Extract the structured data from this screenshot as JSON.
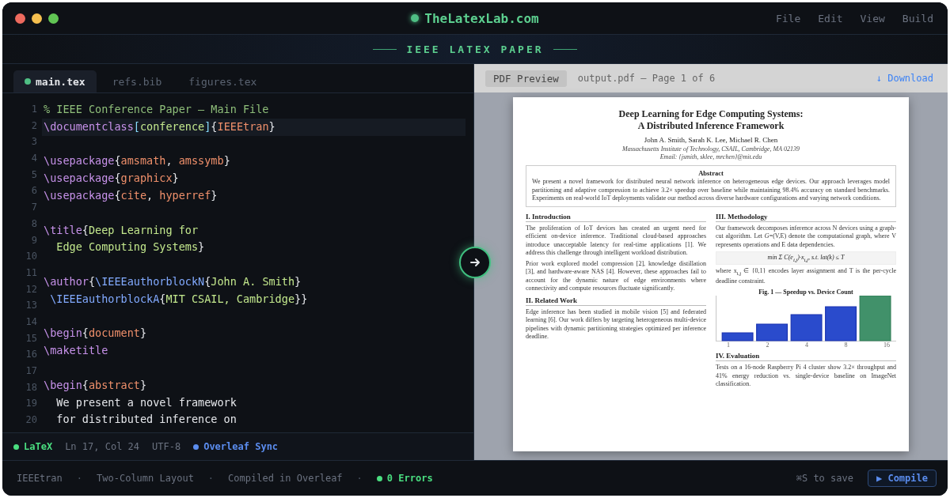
{
  "window": {
    "title": "TheLatexLab.com",
    "menu": [
      "File",
      "Edit",
      "View",
      "Build"
    ]
  },
  "banner": "IEEE LATEX PAPER",
  "editor": {
    "tabs": [
      {
        "label": "main.tex",
        "selected": true
      },
      {
        "label": "refs.bib",
        "selected": false
      },
      {
        "label": "figures.tex",
        "selected": false
      }
    ],
    "line_numbers": [
      "1",
      "2",
      "3",
      "4",
      "5",
      "6",
      "7",
      "8",
      "9",
      "10",
      "11",
      "12",
      "13",
      "14",
      "15",
      "16",
      "17",
      "18",
      "19",
      "20"
    ],
    "lines": [
      {
        "current": false,
        "tokens": [
          {
            "kind": "comment",
            "t": "% IEEE Conference Paper — Main File"
          }
        ]
      },
      {
        "current": true,
        "tokens": [
          {
            "kind": "cmd",
            "t": "\\documentclass"
          },
          {
            "kind": "opt",
            "t": "["
          },
          {
            "kind": "title",
            "t": "conference"
          },
          {
            "kind": "opt",
            "t": "]"
          },
          {
            "kind": "punct",
            "t": "{"
          },
          {
            "kind": "arg",
            "t": "IEEEtran"
          },
          {
            "kind": "punct",
            "t": "}"
          }
        ]
      },
      {
        "current": false
      },
      {
        "current": false,
        "tokens": [
          {
            "kind": "cmd",
            "t": "\\usepackage"
          },
          {
            "kind": "punct",
            "t": "{"
          },
          {
            "kind": "arg",
            "t": "amsmath"
          },
          {
            "kind": "punct",
            "t": ", "
          },
          {
            "kind": "arg",
            "t": "amssymb"
          },
          {
            "kind": "punct",
            "t": "}"
          }
        ]
      },
      {
        "current": false,
        "tokens": [
          {
            "kind": "cmd",
            "t": "\\usepackage"
          },
          {
            "kind": "punct",
            "t": "{"
          },
          {
            "kind": "arg",
            "t": "graphicx"
          },
          {
            "kind": "punct",
            "t": "}"
          }
        ]
      },
      {
        "current": false,
        "tokens": [
          {
            "kind": "cmd",
            "t": "\\usepackage"
          },
          {
            "kind": "punct",
            "t": "{"
          },
          {
            "kind": "arg",
            "t": "cite"
          },
          {
            "kind": "punct",
            "t": ", "
          },
          {
            "kind": "arg",
            "t": "hyperref"
          },
          {
            "kind": "punct",
            "t": "}"
          }
        ]
      },
      {
        "current": false
      },
      {
        "current": false,
        "tokens": [
          {
            "kind": "cmd",
            "t": "\\title"
          },
          {
            "kind": "punct",
            "t": "{"
          },
          {
            "kind": "title",
            "t": "Deep Learning for"
          }
        ]
      },
      {
        "current": false,
        "tokens": [
          {
            "kind": "title",
            "t": "  Edge Computing Systems"
          },
          {
            "kind": "punct",
            "t": "}"
          }
        ]
      },
      {
        "current": false
      },
      {
        "current": false,
        "tokens": [
          {
            "kind": "cmd",
            "t": "\\author"
          },
          {
            "kind": "punct",
            "t": "{"
          },
          {
            "kind": "ref",
            "t": "\\IEEEauthorblockN"
          },
          {
            "kind": "punct",
            "t": "{"
          },
          {
            "kind": "title",
            "t": "John A. Smith"
          },
          {
            "kind": "punct",
            "t": "}"
          }
        ]
      },
      {
        "current": false,
        "tokens": [
          {
            "kind": "ref",
            "t": " \\IEEEauthorblockA"
          },
          {
            "kind": "punct",
            "t": "{"
          },
          {
            "kind": "title",
            "t": "MIT CSAIL, Cambridge"
          },
          {
            "kind": "punct",
            "t": "}}"
          }
        ]
      },
      {
        "current": false
      },
      {
        "current": false,
        "tokens": [
          {
            "kind": "cmd",
            "t": "\\begin"
          },
          {
            "kind": "punct",
            "t": "{"
          },
          {
            "kind": "arg",
            "t": "document"
          },
          {
            "kind": "punct",
            "t": "}"
          }
        ]
      },
      {
        "current": false,
        "tokens": [
          {
            "kind": "cmd",
            "t": "\\maketitle"
          }
        ]
      },
      {
        "current": false
      },
      {
        "current": false,
        "tokens": [
          {
            "kind": "cmd",
            "t": "\\begin"
          },
          {
            "kind": "punct",
            "t": "{"
          },
          {
            "kind": "arg",
            "t": "abstract"
          },
          {
            "kind": "punct",
            "t": "}"
          }
        ]
      },
      {
        "current": false,
        "tokens": [
          {
            "kind": "text",
            "t": "  We present a novel framework"
          }
        ]
      },
      {
        "current": false,
        "tokens": [
          {
            "kind": "text",
            "t": "  for distributed inference on"
          }
        ]
      }
    ],
    "status": [
      {
        "label": "LaTeX",
        "color": "#4ade80",
        "dot": true
      },
      {
        "label": "Ln 17, Col 24",
        "dot": false
      },
      {
        "label": "UTF-8",
        "dot": false
      },
      {
        "label": "Overleaf Sync",
        "color": "#5b8def",
        "dot": true
      }
    ]
  },
  "preview": {
    "badge": "PDF Preview",
    "file": "output.pdf — Page 1 of 6",
    "download": "↓ Download",
    "paper": {
      "title": [
        "Deep Learning for Edge Computing Systems:",
        "A Distributed Inference Framework"
      ],
      "authors": "John A. Smith, Sarah K. Lee, Michael R. Chen",
      "affiliation": "Massachusetts Institute of Technology, CSAIL, Cambridge, MA 02139",
      "email": "Email: {jsmith, sklee, mrchen}@mit.edu",
      "abstract_heading": "Abstract",
      "abstract": "We present a novel framework for distributed neural network inference on heterogeneous edge devices. Our approach leverages model partitioning and adaptive compression to achieve 3.2× speedup over baseline while maintaining 98.4% accuracy on standard benchmarks. Experiments on real-world IoT deployments validate our method across diverse hardware configurations and varying network conditions.",
      "columns": [
        [
          {
            "kind": "heading",
            "text": "I. Introduction"
          },
          {
            "kind": "para",
            "text": "The proliferation of IoT devices has created an urgent need for efficient on-device inference. Traditional cloud-based approaches introduce unacceptable latency for real-time applications [1]. We address this challenge through intelligent workload distribution."
          },
          {
            "kind": "para",
            "text": "Prior work explored model compression [2], knowledge distillation [3], and hardware-aware NAS [4]. However, these approaches fail to account for the dynamic nature of edge environments where connectivity and compute resources fluctuate significantly."
          },
          {
            "kind": "heading",
            "text": "II. Related Work"
          },
          {
            "kind": "para",
            "text": "Edge inference has been studied in mobile vision [5] and federated learning [6]. Our work differs by targeting heterogeneous multi-device pipelines with dynamic partitioning strategies optimized per inference deadline."
          }
        ],
        [
          {
            "kind": "heading",
            "text": "III. Methodology"
          },
          {
            "kind": "para",
            "text": "Our framework decomposes inference across N devices using a graph-cut algorithm. Let *G*=(V,E) denote the computational graph, where V represents operations and E data dependencies."
          },
          {
            "kind": "equation",
            "text": "min Σ C(e$_{i,j}$)·x$_{i,j}$, s.t. lat(k) ≤ T"
          },
          {
            "kind": "para",
            "text": "where x$_{i,j}$ ∈ {0,1} encodes layer assignment and T is the per-cycle deadline constraint."
          },
          {
            "kind": "figure",
            "caption": "Fig. 1 — Speedup vs. Device Count",
            "axis_labels": [
              "1",
              "2",
              "4",
              "8",
              "16"
            ]
          },
          {
            "kind": "heading",
            "text": "IV. Evaluation"
          },
          {
            "kind": "para",
            "text": "Tests on a 16-node Raspberry Pi 4 cluster show 3.2× throughput and 41% energy reduction vs. single-device baseline on ImageNet classification."
          }
        ]
      ]
    }
  },
  "footer": {
    "items": [
      {
        "kind": "text",
        "text": "IEEEtran"
      },
      {
        "kind": "sep",
        "text": "·"
      },
      {
        "kind": "text",
        "text": "Two-Column Layout"
      },
      {
        "kind": "sep",
        "text": "·"
      },
      {
        "kind": "text",
        "text": "Compiled in Overleaf"
      },
      {
        "kind": "sep",
        "text": "·"
      },
      {
        "kind": "status",
        "text": "0 Errors",
        "color": "#4ade80"
      }
    ],
    "hint": "⌘S to save",
    "button": "▶ Compile"
  }
}
